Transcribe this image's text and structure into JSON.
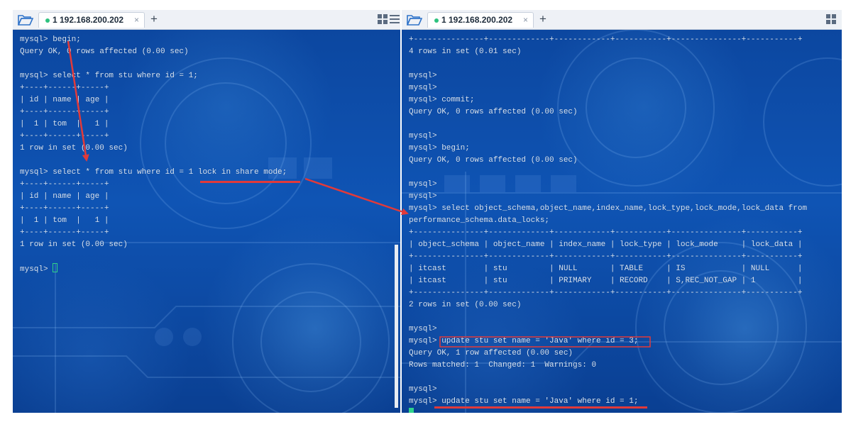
{
  "left_pane": {
    "tab_title": "1 192.168.200.202",
    "lines": [
      "mysql> begin;",
      "Query OK, 0 rows affected (0.00 sec)",
      "",
      "mysql> select * from stu where id = 1;",
      "+----+------+-----+",
      "| id | name | age |",
      "+----+------+-----+",
      "|  1 | tom  |   1 |",
      "+----+------+-----+",
      "1 row in set (0.00 sec)",
      "",
      "mysql> select * from stu where id = 1 lock in share mode;",
      "+----+------+-----+",
      "| id | name | age |",
      "+----+------+-----+",
      "|  1 | tom  |   1 |",
      "+----+------+-----+",
      "1 row in set (0.00 sec)",
      "",
      "mysql> "
    ]
  },
  "right_pane": {
    "tab_title": "1 192.168.200.202",
    "lines": [
      "+---------------+-------------+------------+-----------+---------------+-----------+",
      "4 rows in set (0.01 sec)",
      "",
      "mysql>",
      "mysql>",
      "mysql> commit;",
      "Query OK, 0 rows affected (0.00 sec)",
      "",
      "mysql>",
      "mysql> begin;",
      "Query OK, 0 rows affected (0.00 sec)",
      "",
      "mysql>",
      "mysql>",
      "mysql> select object_schema,object_name,index_name,lock_type,lock_mode,lock_data from",
      "performance_schema.data_locks;",
      "+---------------+-------------+------------+-----------+---------------+-----------+",
      "| object_schema | object_name | index_name | lock_type | lock_mode     | lock_data |",
      "+---------------+-------------+------------+-----------+---------------+-----------+",
      "| itcast        | stu         | NULL       | TABLE     | IS            | NULL      |",
      "| itcast        | stu         | PRIMARY    | RECORD    | S,REC_NOT_GAP | 1         |",
      "+---------------+-------------+------------+-----------+---------------+-----------+",
      "2 rows in set (0.00 sec)",
      "",
      "mysql>",
      "mysql> update stu set name = 'Java' where id = 3;",
      "Query OK, 1 row affected (0.00 sec)",
      "Rows matched: 1  Changed: 1  Warnings: 0",
      "",
      "mysql>",
      "mysql> update stu set name = 'Java' where id = 1;"
    ]
  },
  "icons": {
    "folder": "folder-open-icon",
    "status_dot": "connected-dot-icon",
    "close": "close-icon",
    "new_tab": "plus-icon",
    "layout_grid": "grid-layout-icon",
    "menu": "menu-icon"
  },
  "colors": {
    "terminal_bg": "#0d4aa3",
    "terminal_text": "#d7e4f5",
    "cursor": "#2fd28b",
    "annotation": "#e13a3a",
    "status_dot": "#2ec27e"
  },
  "tab_controls": {
    "close_glyph": "×",
    "new_tab_glyph": "+"
  }
}
